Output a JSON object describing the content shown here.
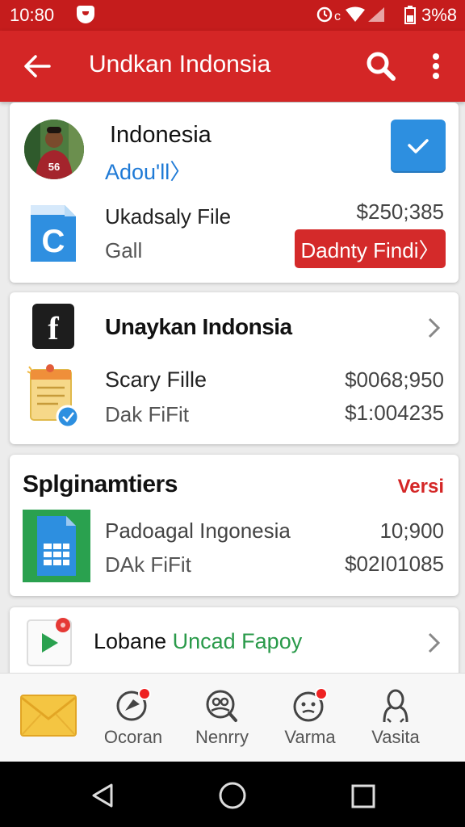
{
  "status_bar": {
    "time": "10:80",
    "battery": "3%8",
    "icons": [
      "alarm-icon",
      "wifi-icon",
      "signal-icon",
      "battery-icon"
    ]
  },
  "app_bar": {
    "title": "Undkan Indonsia"
  },
  "card1": {
    "title": "Indonesia",
    "link": "Adou'll〉",
    "jersey_number": "56",
    "file_name": "Ukadsaly File",
    "file_sub": "Gall",
    "amount": "$250;385",
    "button_label": "Dadnty Findi〉",
    "colors": {
      "check": "#2d8fe0",
      "button": "#d42a2a",
      "link": "#1f7ad6"
    }
  },
  "card2": {
    "title": "Unaykan Indonsia",
    "file_name": "Scary Fille",
    "file_sub": "Dak FiFit",
    "amount1": "$0068;950",
    "amount2": "$1:004235"
  },
  "card3": {
    "title": "Splginamtiers",
    "tag": "Versi",
    "file_name": "Padoagal Ingonesia",
    "file_sub": "DAk FiFit",
    "amount1": "10;900",
    "amount2": "$02I01085"
  },
  "card4": {
    "title_part1": "Lobane",
    "title_part2": "Uncad Fapoy"
  },
  "bottom_nav": [
    {
      "label": "",
      "icon": "mail-icon"
    },
    {
      "label": "Ocoran",
      "icon": "chat-icon"
    },
    {
      "label": "Nenrry",
      "icon": "people-icon"
    },
    {
      "label": "Varma",
      "icon": "face-icon"
    },
    {
      "label": "Vasita",
      "icon": "person-icon"
    }
  ],
  "accent": "#d42626"
}
